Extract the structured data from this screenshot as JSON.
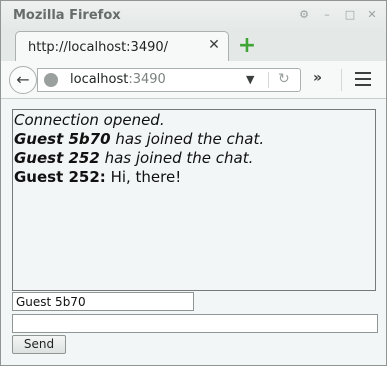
{
  "window": {
    "title": "Mozilla Firefox"
  },
  "tab": {
    "label": "http://localhost:3490/",
    "close_glyph": "✕",
    "new_tab_glyph": "+"
  },
  "navbar": {
    "url_host": "localhost",
    "url_port": ":3490",
    "overflow_glyph": "»"
  },
  "chat": {
    "lines": [
      {
        "kind": "status",
        "text": "Connection opened."
      },
      {
        "kind": "join",
        "user": "Guest 5b70",
        "text": " has joined the chat."
      },
      {
        "kind": "join",
        "user": "Guest 252",
        "text": " has joined the chat."
      },
      {
        "kind": "message",
        "user": "Guest 252:",
        "text": " Hi, there!"
      }
    ]
  },
  "form": {
    "name_value": "Guest 5b70",
    "message_value": "",
    "send_label": "Send"
  },
  "icons": {
    "back": "back-arrow-icon",
    "site": "globe-icon",
    "dropdown": "chevron-down-icon",
    "reload": "reload-icon",
    "menu": "hamburger-menu-icon",
    "new_tab": "plus-icon"
  },
  "colors": {
    "new_tab_accent": "#3fa535",
    "page_background": "#f2f6f6"
  }
}
